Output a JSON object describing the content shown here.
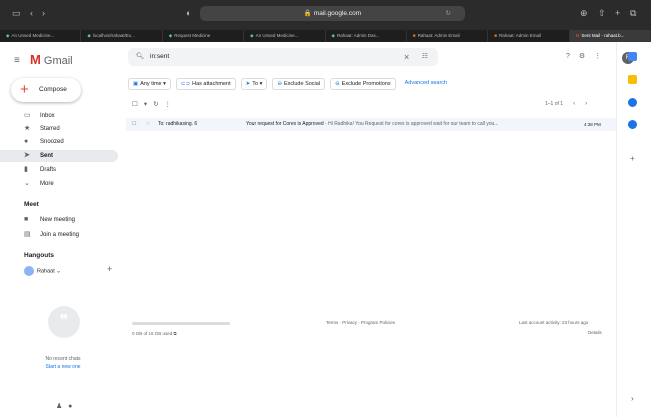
{
  "browser": {
    "url": "mail.google.com",
    "tabs": [
      {
        "label": "An Unsed Medicine...",
        "color": "#34a853"
      },
      {
        "label": "localhost/rahaat/Ex...",
        "color": "#34a853"
      },
      {
        "label": "Request Medicine",
        "color": "#34a853"
      },
      {
        "label": "An Unsed Medicine...",
        "color": "#34a853"
      },
      {
        "label": "Rahaat: Admin Das...",
        "color": "#34a853"
      },
      {
        "label": "Rahaat: Admin Email",
        "color": "#e57c2e"
      },
      {
        "label": "Rahaat: Admin Email",
        "color": "#e57c2e"
      },
      {
        "label": "Sent Mail - rahaat.b...",
        "color": "#ea4335",
        "active": true
      }
    ]
  },
  "header": {
    "app_name": "Gmail",
    "search_value": "in:sent",
    "avatar_letter": "R"
  },
  "sidebar": {
    "compose": "Compose",
    "items": [
      {
        "label": "Inbox",
        "icon": "inbox-icon"
      },
      {
        "label": "Starred",
        "icon": "star-icon"
      },
      {
        "label": "Snoozed",
        "icon": "clock-icon"
      },
      {
        "label": "Sent",
        "icon": "send-icon",
        "selected": true
      },
      {
        "label": "Drafts",
        "icon": "draft-icon"
      },
      {
        "label": "More",
        "icon": "chevron-down-icon"
      }
    ],
    "meet": {
      "heading": "Meet",
      "new_meeting": "New meeting",
      "join": "Join a meeting"
    },
    "hangouts": {
      "heading": "Hangouts",
      "user": "Rahaat",
      "no_chats": "No recent chats",
      "start": "Start a new one"
    }
  },
  "filters": {
    "any_time": "Any time",
    "has_attachment": "Has attachment",
    "to": "To",
    "exclude_social": "Exclude Social",
    "exclude_promotions": "Exclude Promotions",
    "advanced": "Advanced search"
  },
  "pager": {
    "range": "1–1 of 1"
  },
  "emails": [
    {
      "to": "To: radhikasing. 6",
      "subject": "Your request for Corex is Approved",
      "snippet": " - Hi Radhika! You Request for corex is approved wait for our team to call you...",
      "time": "4:38 PM"
    }
  ],
  "footer": {
    "storage": "0 GB of 15 GB used",
    "links": "Terms · Privacy · Program Policies",
    "activity": "Last account activity: 23 hours ago",
    "details": "Details"
  }
}
